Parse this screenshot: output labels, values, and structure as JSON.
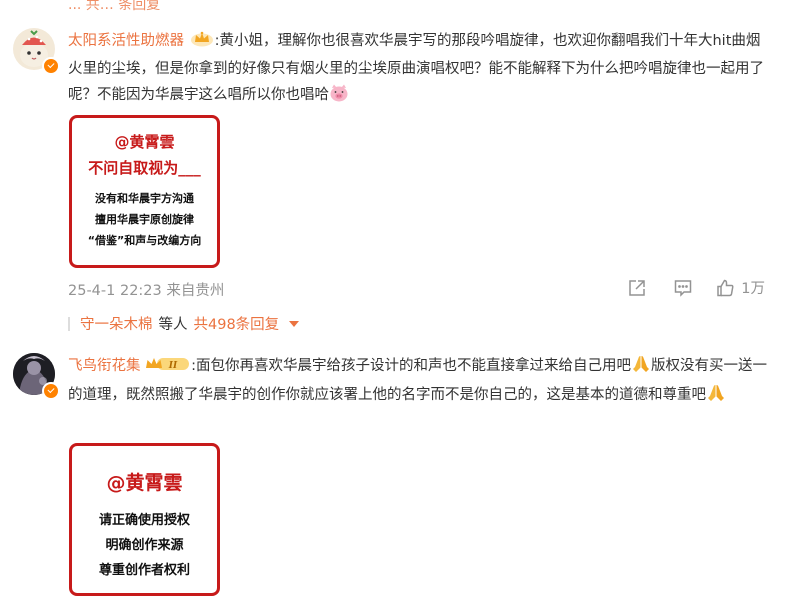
{
  "top_fragment": "... 共… 条回复",
  "comments": [
    {
      "username": "太阳系活性助燃器",
      "text": ":黄小姐，理解你也很喜欢华晨宇写的那段吟唱旋律，也欢迎你翻唱我们十年大hit曲烟火里的尘埃，但是你拿到的好像只有烟火里的尘埃原曲演唱权吧？能不能解释下为什么把吟唱旋律也一起用了呢？不能因为华晨宇这么唱所以你也唱哈",
      "card": {
        "mention": "@黄霄雲",
        "headline": "不问自取视为___",
        "lines": [
          "没有和华晨宇方沟通",
          "擅用华晨宇原创旋律",
          "“借鉴”和声与改编方向"
        ]
      },
      "time": "25-4-1 22:23",
      "source": "来自贵州",
      "like_count": "1万",
      "replies": {
        "first_user": "守一朵木棉",
        "middle": "等人",
        "count_text": "共498条回复"
      }
    },
    {
      "username": "飞鸟衔花集",
      "vip_level": "II",
      "text": ":面包你再喜欢华晨宇给孩子设计的和声也不能直接拿过来给自己用吧",
      "text2": "版权没有买一送一的道理，既然照搬了华晨宇的创作你就应该署上他的名字而不是你自己的，这是基本的道德和尊重吧",
      "card": {
        "mention": "@黄霄雲",
        "lines": [
          "请正确使用授权",
          "明确创作来源",
          "尊重创作者权利"
        ]
      }
    }
  ],
  "colors": {
    "username": "#eb7340",
    "card_border": "#c71a1a",
    "meta": "#939393"
  }
}
